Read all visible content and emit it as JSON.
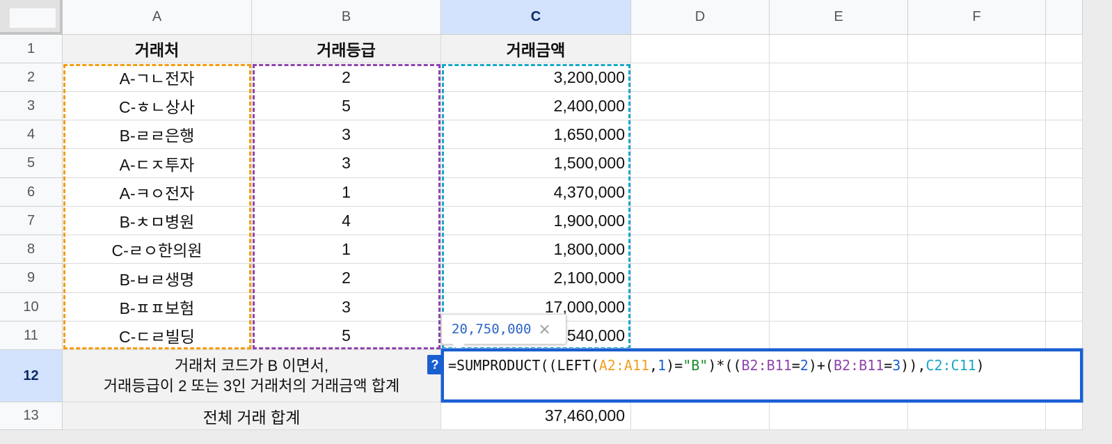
{
  "columns": [
    {
      "label": "A",
      "selected": false
    },
    {
      "label": "B",
      "selected": false
    },
    {
      "label": "C",
      "selected": true
    },
    {
      "label": "D",
      "selected": false
    },
    {
      "label": "E",
      "selected": false
    },
    {
      "label": "F",
      "selected": false
    }
  ],
  "rows": [
    "1",
    "2",
    "3",
    "4",
    "5",
    "6",
    "7",
    "8",
    "9",
    "10",
    "11",
    "12",
    "13"
  ],
  "selected_row": "12",
  "header_row": {
    "a": "거래처",
    "b": "거래등급",
    "c": "거래금액"
  },
  "data_rows": [
    {
      "a": "A-ㄱㄴ전자",
      "b": "2",
      "c": "3,200,000"
    },
    {
      "a": "C-ㅎㄴ상사",
      "b": "5",
      "c": "2,400,000"
    },
    {
      "a": "B-ㄹㄹ은행",
      "b": "3",
      "c": "1,650,000"
    },
    {
      "a": "A-ㄷㅈ투자",
      "b": "3",
      "c": "1,500,000"
    },
    {
      "a": "A-ㅋㅇ전자",
      "b": "1",
      "c": "4,370,000"
    },
    {
      "a": "B-ㅊㅁ병원",
      "b": "4",
      "c": "1,900,000"
    },
    {
      "a": "C-ㄹㅇ한의원",
      "b": "1",
      "c": "1,800,000"
    },
    {
      "a": "B-ㅂㄹ생명",
      "b": "2",
      "c": "2,100,000"
    },
    {
      "a": "B-ㅍㅍ보험",
      "b": "3",
      "c": "17,000,000"
    },
    {
      "a": "C-ㄷㄹ빌딩",
      "b": "5",
      "c": "1,540,000"
    }
  ],
  "row12": {
    "line1": "거래처 코드가 B 이면서,",
    "line2": "거래등급이 2 또는 3인 거래처의 거래금액 합계"
  },
  "row13": {
    "label": "전체 거래 합계",
    "value": "37,460,000"
  },
  "tooltip": {
    "value": "20,750,000",
    "close": "×"
  },
  "help_label": "?",
  "formula_tokens": [
    {
      "t": "=SUMPRODUCT((LEFT(",
      "c": "tk-fn"
    },
    {
      "t": "A2:A11",
      "c": "tk-a"
    },
    {
      "t": ",",
      "c": "tk-fn"
    },
    {
      "t": "1",
      "c": "tk-num"
    },
    {
      "t": ")=",
      "c": "tk-fn"
    },
    {
      "t": "\"B\"",
      "c": "tk-str"
    },
    {
      "t": ")*((",
      "c": "tk-fn"
    },
    {
      "t": "B2:B11",
      "c": "tk-b"
    },
    {
      "t": "=",
      "c": "tk-fn"
    },
    {
      "t": "2",
      "c": "tk-num"
    },
    {
      "t": ")+(",
      "c": "tk-fn"
    },
    {
      "t": "B2:B11",
      "c": "tk-b"
    },
    {
      "t": "=",
      "c": "tk-fn"
    },
    {
      "t": "3",
      "c": "tk-num"
    },
    {
      "t": ")),",
      "c": "tk-fn"
    },
    {
      "t": "C2:C11",
      "c": "tk-c"
    },
    {
      "t": ")",
      "c": "tk-fn"
    }
  ],
  "colors": {
    "range_a": "#f39c12",
    "range_b": "#8e44ad",
    "range_c": "#19a7c9",
    "selection": "#1a5fd0"
  }
}
